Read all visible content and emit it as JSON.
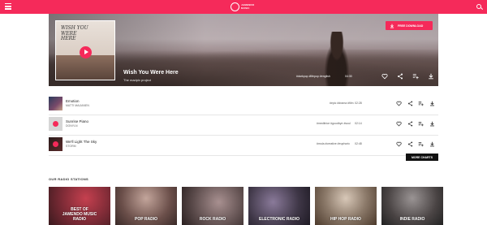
{
  "header": {
    "logo_text": "JAMENDO MUSIC",
    "icons": [
      "menu-icon",
      "logo-icon",
      "search-icon"
    ],
    "accent_color": "#f52a5a"
  },
  "hero": {
    "cover_title": "WISH YOU WERE HERE",
    "title": "Wish You Were Here",
    "artist": "The madpix project",
    "tags": "#darkpop #lifepop #english",
    "duration": "04:30",
    "download_label": "FREE DOWNLOAD",
    "actions": [
      "heart-icon",
      "share-icon",
      "add-to-playlist-icon",
      "download-icon"
    ]
  },
  "tracks": [
    {
      "title": "Emotion",
      "artist": "MATTI MAIJANEN",
      "tags": "#epic #drama #film",
      "duration": "02:28"
    },
    {
      "title": "Sunrise Piano",
      "artist": "DONYLN",
      "tags": "#meditrice #goodbye #soul",
      "duration": "02:14"
    },
    {
      "title": "We'll Light The Sky",
      "artist": "STORM",
      "tags": "#mola #creative #euphoric",
      "duration": "02:48"
    }
  ],
  "more_charts_label": "MORE CHARTS",
  "radio": {
    "heading": "OUR RADIO STATIONS",
    "stations": [
      {
        "label": "BEST OF JAMENDO MUSIC RADIO",
        "color": "#7a2a35"
      },
      {
        "label": "POP RADIO",
        "color": "#6b4f4a"
      },
      {
        "label": "ROCK RADIO",
        "color": "#5a4a4a"
      },
      {
        "label": "ELECTRONIC RADIO",
        "color": "#3e3646"
      },
      {
        "label": "HIP HOP RADIO",
        "color": "#5c4a3c"
      },
      {
        "label": "INDIE RADIO",
        "color": "#4a4444"
      }
    ]
  }
}
